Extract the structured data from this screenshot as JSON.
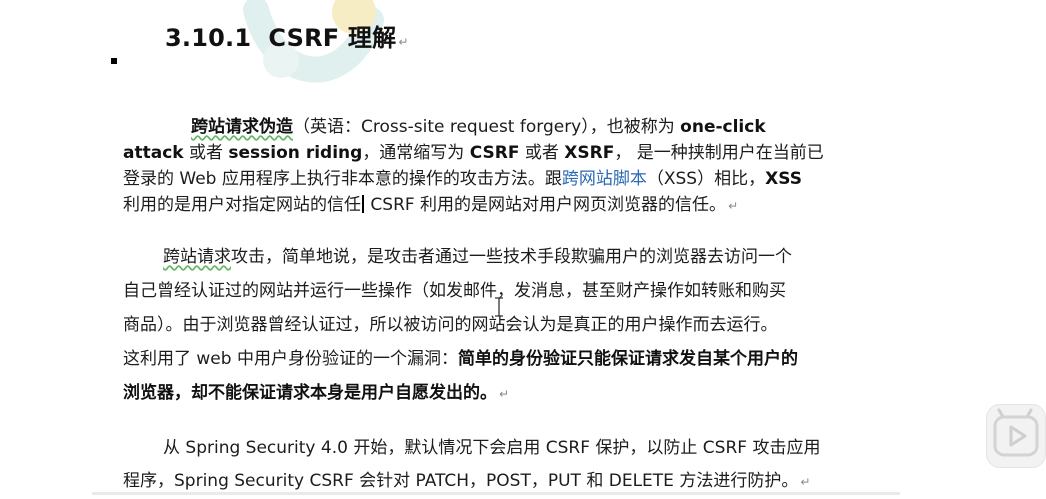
{
  "heading": {
    "number": "3.10.1",
    "title": "CSRF 理解",
    "mark": "↵"
  },
  "p1": {
    "l1": [
      {
        "t": "跨站请求伪造",
        "s": "bsquig"
      },
      {
        "t": "（英语：Cross-site request forgery），也被称为 ",
        "s": "n"
      },
      {
        "t": "one-click",
        "s": "b"
      }
    ],
    "l2": [
      {
        "t": "attack",
        "s": "b"
      },
      {
        "t": " 或者 ",
        "s": "n"
      },
      {
        "t": "session riding",
        "s": "b"
      },
      {
        "t": "，通常缩写为 ",
        "s": "n"
      },
      {
        "t": "CSRF",
        "s": "b"
      },
      {
        "t": " 或者 ",
        "s": "n"
      },
      {
        "t": "XSRF",
        "s": "b"
      },
      {
        "t": "，  是一种挟制用户在当前已",
        "s": "n"
      }
    ],
    "l3": [
      {
        "t": "登录的 Web 应用程序上执行非本意的操作的攻击方法。跟",
        "s": "n"
      },
      {
        "t": "跨网站脚本",
        "s": "link"
      },
      {
        "t": "（XSS）相比，",
        "s": "n"
      },
      {
        "t": "XSS",
        "s": "b"
      }
    ],
    "l4a": "利用的是用户对指定网站的信任",
    "l4b": "  CSRF  利用的是网站对用户网页浏览器的信任。",
    "mark": "↵"
  },
  "p2": {
    "l1a": "跨站请求",
    "l1b": "攻击，简单地说，是攻击者通过一些技术手段欺骗用户的浏览器去访问一个",
    "l2": "自己曾经认证过的网站并运行一些操作（如发邮件，发消息，甚至财产操作如转账和购买",
    "l3": "商品）。由于浏览器曾经认证过，所以被访问的网站会认为是真正的用户操作而去运行。",
    "l4a": "这利用了 web 中用户身份验证的一个漏洞：",
    "l4b": "简单的身份验证只能保证请求发自某个用户的",
    "l5": "浏览器，却不能保证请求本身是用户自愿发出的。",
    "mark": "↵"
  },
  "p3": {
    "l1": "从 Spring Security 4.0 开始，默认情况下会启用 CSRF 保护，以防止 CSRF 攻击应用",
    "l2": "程序，Spring Security CSRF 会针对 PATCH，POST，PUT 和 DELETE 方法进行防护。",
    "mark": "↵"
  },
  "colors": {
    "link": "#2a6bb3",
    "squiggle": "#63b563",
    "watermark": "#f3e7a8"
  },
  "icons": {
    "watermark": "logo-watermark-icon",
    "play": "play-icon",
    "cursor": "text-cursor-icon"
  }
}
